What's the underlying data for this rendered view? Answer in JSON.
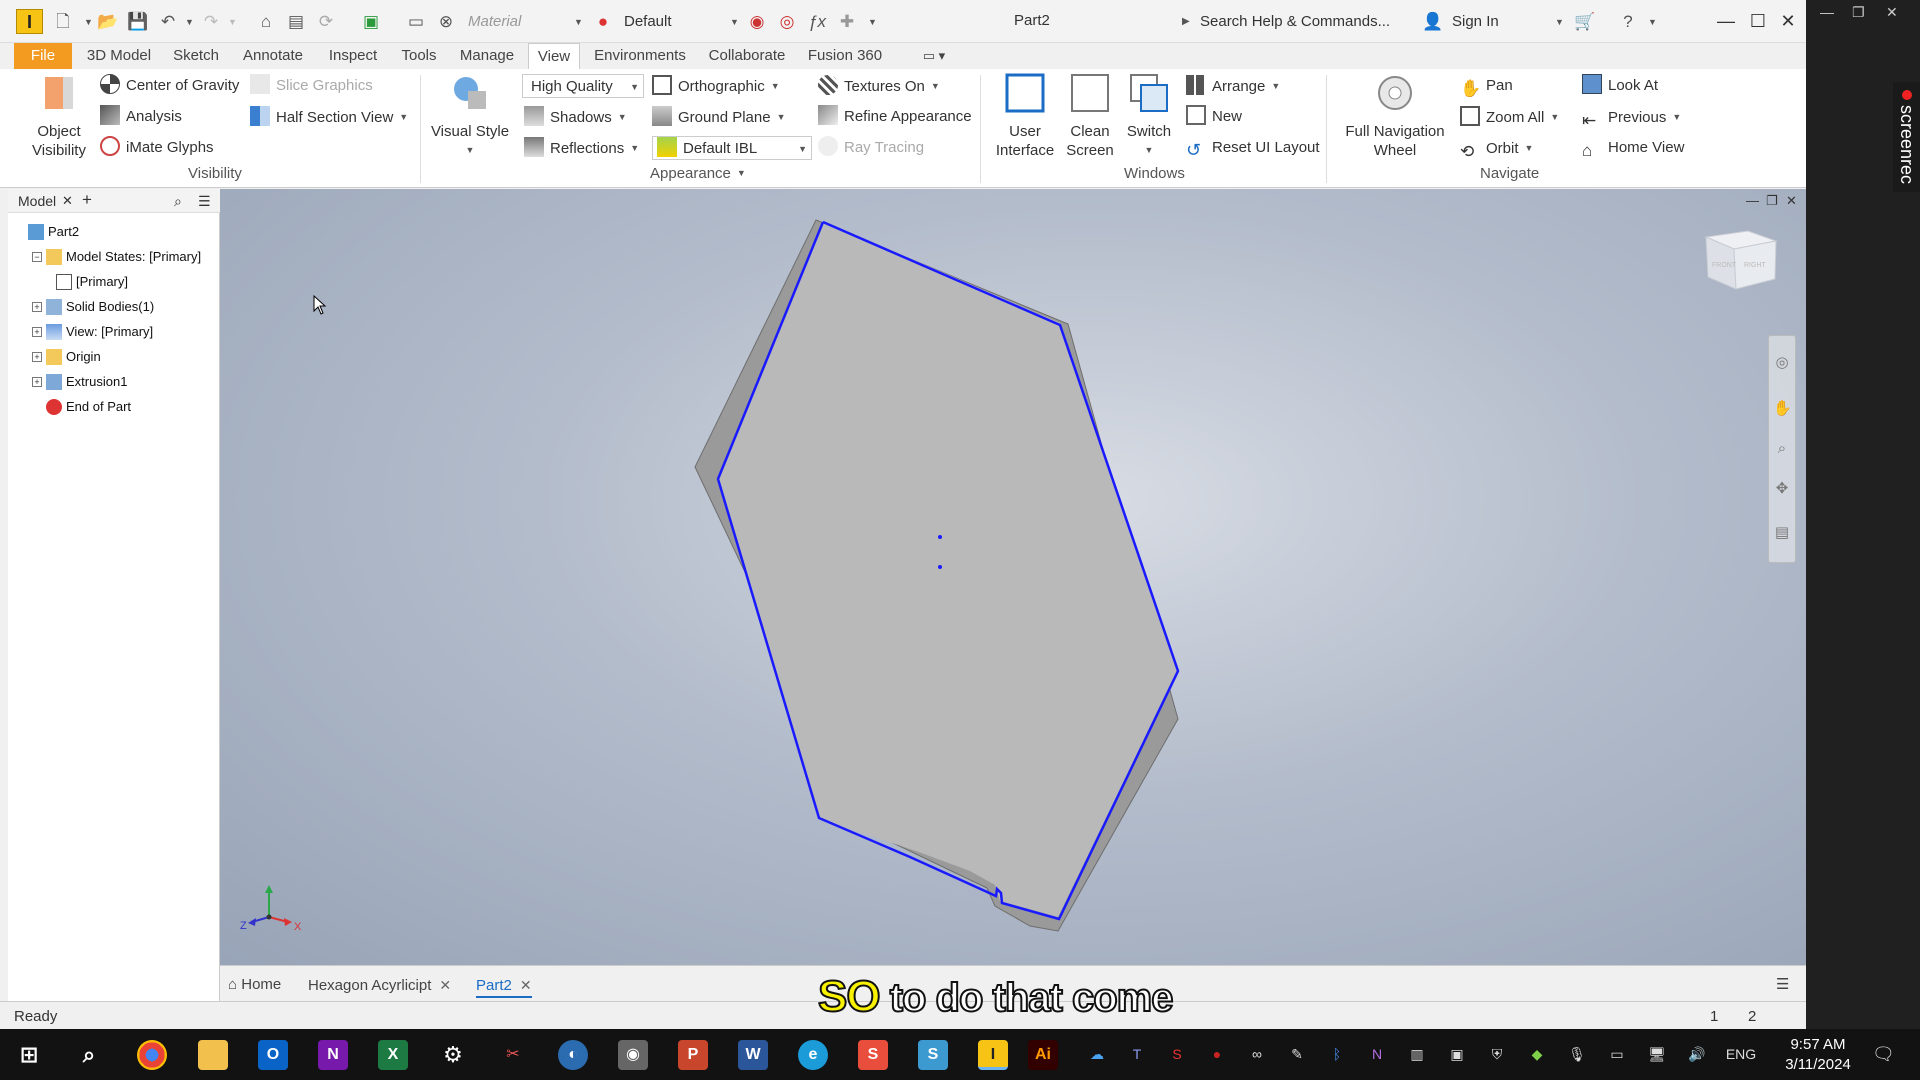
{
  "titlebar": {
    "logo": "I",
    "material_placeholder": "Material",
    "appearance_value": "Default",
    "document_title": "Part2",
    "search_label": "Search Help & Commands...",
    "signin_label": "Sign In"
  },
  "tabs": [
    "File",
    "3D Model",
    "Sketch",
    "Annotate",
    "Inspect",
    "Tools",
    "Manage",
    "View",
    "Environments",
    "Collaborate",
    "Fusion 360"
  ],
  "active_tab": "View",
  "ribbon": {
    "visibility": {
      "object_visibility": "Object\nVisibility",
      "center_of_gravity": "Center of Gravity",
      "slice_graphics": "Slice Graphics",
      "analysis": "Analysis",
      "half_section_view": "Half Section View",
      "imate_glyphs": "iMate Glyphs",
      "group_label": "Visibility"
    },
    "appearance": {
      "visual_style": "Visual Style",
      "quality": "High Quality",
      "orthographic": "Orthographic",
      "textures": "Textures On",
      "shadows": "Shadows",
      "ground_plane": "Ground Plane",
      "refine_appearance": "Refine Appearance",
      "reflections": "Reflections",
      "ibl": "Default IBL",
      "ray_tracing": "Ray Tracing",
      "group_label": "Appearance"
    },
    "windows": {
      "user_interface": "User\nInterface",
      "clean_screen": "Clean\nScreen",
      "switch": "Switch",
      "arrange": "Arrange",
      "new": "New",
      "reset_ui": "Reset UI Layout",
      "group_label": "Windows"
    },
    "navigate": {
      "full_nav_wheel": "Full Navigation\nWheel",
      "pan": "Pan",
      "zoom_all": "Zoom All",
      "orbit": "Orbit",
      "look_at": "Look At",
      "previous": "Previous",
      "home_view": "Home View",
      "group_label": "Navigate"
    }
  },
  "browser": {
    "tab_label": "Model",
    "tree": [
      {
        "label": "Part2",
        "indent": 0,
        "expander": "",
        "icon": "part-icon"
      },
      {
        "label": "Model States: [Primary]",
        "indent": 1,
        "expander": "−",
        "icon": "folder-icon"
      },
      {
        "label": "[Primary]",
        "indent": 2,
        "expander": "",
        "icon": "model-state-icon"
      },
      {
        "label": "Solid Bodies(1)",
        "indent": 1,
        "expander": "+",
        "icon": "solid-bodies-icon"
      },
      {
        "label": "View: [Primary]",
        "indent": 1,
        "expander": "+",
        "icon": "view-icon"
      },
      {
        "label": "Origin",
        "indent": 1,
        "expander": "+",
        "icon": "folder-icon"
      },
      {
        "label": "Extrusion1",
        "indent": 1,
        "expander": "+",
        "icon": "extrusion-icon"
      },
      {
        "label": "End of Part",
        "indent": 1,
        "expander": "",
        "icon": "end-of-part-icon"
      }
    ]
  },
  "viewcube": {
    "front": "FRONT",
    "right": "RIGHT"
  },
  "axis": {
    "x": "X",
    "y": "Y",
    "z": "Z"
  },
  "doctabs": {
    "home": "Home",
    "hexagon": "Hexagon Acyrlicipt",
    "part2": "Part2"
  },
  "status": {
    "text": "Ready",
    "page1": "1",
    "page2": "2"
  },
  "caption": {
    "highlight": "SO",
    "rest": " to do that come"
  },
  "screenrec": "screenrec",
  "clock": {
    "time": "9:57 AM",
    "date": "3/11/2024"
  },
  "tray": {
    "lang": "ENG"
  },
  "colors": {
    "accent": "#1a6cc4",
    "file_tab": "#f39b21",
    "edge_highlight": "#1a1aff",
    "part_face": "#b8b8b8"
  }
}
